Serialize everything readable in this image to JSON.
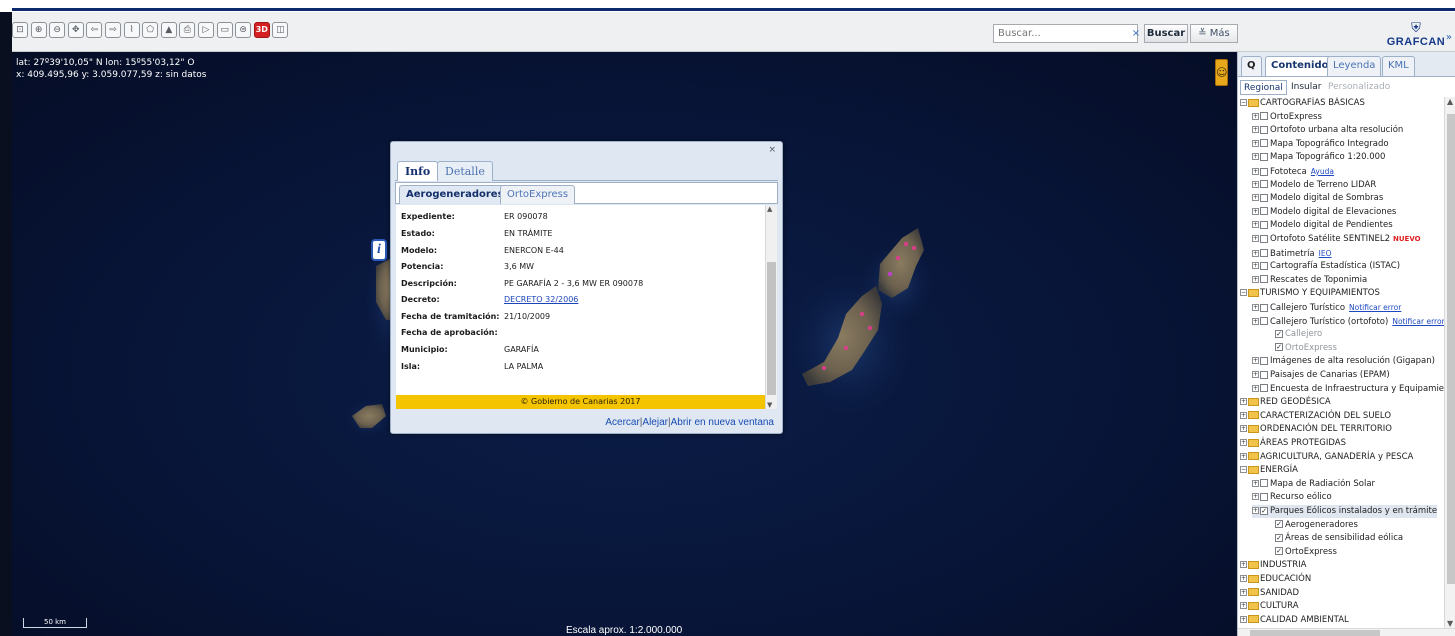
{
  "toolbar": {
    "tools": [
      "full-extent",
      "zoom-in",
      "zoom-out",
      "pan",
      "previous-view",
      "next-view",
      "measure-distance",
      "measure-area",
      "elevation-profile",
      "print",
      "draw",
      "layer-swipe",
      "layers",
      "3D",
      "window"
    ],
    "badge_3d": "3D",
    "search_placeholder": "Buscar...",
    "search_clear": "×",
    "search_button": "Buscar",
    "more_button": "≚ Más",
    "logo_shield": "⛨",
    "logo_text": "GRAFCAN",
    "logo_more": "»"
  },
  "map": {
    "coords_line1": "lat: 27º39'10,05\" N  lon: 15º55'03,12\" O",
    "coords_line2": "x: 409.495,96  y: 3.059.077,59  z: sin datos",
    "scale_bar": "50 km",
    "scale_text": "Escala aprox. 1:2.000.000",
    "info_marker": "i",
    "pegman": "☺",
    "colors": {
      "sea": "#081538",
      "land": "#7c6f58"
    }
  },
  "popup": {
    "close": "×",
    "tabs": [
      "Info",
      "Detalle"
    ],
    "sub_tabs": [
      "Aerogeneradores",
      "OrtoExpress"
    ],
    "rows": [
      {
        "label": "Expediente:",
        "value": "ER 090078"
      },
      {
        "label": "Estado:",
        "value": "EN TRÁMITE"
      },
      {
        "label": "Modelo:",
        "value": "ENERCON E-44"
      },
      {
        "label": "Potencia:",
        "value": "3,6 MW"
      },
      {
        "label": "Descripción:",
        "value": "PE GARAFÍA 2 - 3,6 MW ER 090078"
      },
      {
        "label": "Decreto:",
        "value": "DECRETO 32/2006"
      },
      {
        "label": "Fecha de tramitación:",
        "value": "21/10/2009"
      },
      {
        "label": "Fecha de aprobación:",
        "value": ""
      },
      {
        "label": "Municipio:",
        "value": "GARAFÍA"
      },
      {
        "label": "Isla:",
        "value": "LA PALMA"
      }
    ],
    "footer": "© Gobierno de Canarias 2017",
    "footer_color": "#f5c400",
    "links": {
      "acercar": "Acercar",
      "alejar": "Alejar",
      "abrir": "Abrir en nueva ventana",
      "sep": "|"
    }
  },
  "panel": {
    "search_tab": "Q",
    "tabs": [
      "Contenido",
      "Leyenda",
      "KML"
    ],
    "sub_tabs": [
      "Regional",
      "Insular",
      "Personalizado"
    ],
    "tree": [
      {
        "level": 0,
        "type": "folder",
        "label": "CARTOGRAFÍAS BÁSICAS",
        "expanded": true
      },
      {
        "level": 1,
        "type": "layer",
        "label": "OrtoExpress"
      },
      {
        "level": 1,
        "type": "layer",
        "label": "Ortofoto urbana alta resolución"
      },
      {
        "level": 1,
        "type": "layer",
        "label": "Mapa Topográfico Integrado"
      },
      {
        "level": 1,
        "type": "layer",
        "label": "Mapa Topográfico 1:20.000"
      },
      {
        "level": 1,
        "type": "layer",
        "label": "Fototeca",
        "link": "Ayuda"
      },
      {
        "level": 1,
        "type": "layer",
        "label": "Modelo de Terreno LIDAR"
      },
      {
        "level": 1,
        "type": "layer",
        "label": "Modelo digital de Sombras"
      },
      {
        "level": 1,
        "type": "layer",
        "label": "Modelo digital de Elevaciones"
      },
      {
        "level": 1,
        "type": "layer",
        "label": "Modelo digital de Pendientes"
      },
      {
        "level": 1,
        "type": "layer",
        "label": "Ortofoto Satélite SENTINEL2",
        "badge": "NUEVO"
      },
      {
        "level": 1,
        "type": "layer",
        "label": "Batimetría",
        "link": "IEO"
      },
      {
        "level": 1,
        "type": "layer",
        "label": "Cartografía Estadística (ISTAC)"
      },
      {
        "level": 1,
        "type": "layer",
        "label": "Rescates de Toponimia"
      },
      {
        "level": 0,
        "type": "folder",
        "label": "TURISMO Y EQUIPAMIENTOS",
        "expanded": true
      },
      {
        "level": 1,
        "type": "layer",
        "label": "Callejero Turístico",
        "link": "Notificar error"
      },
      {
        "level": 1,
        "type": "layer",
        "label": "Callejero Turístico (ortofoto)",
        "link": "Notificar error"
      },
      {
        "level": 2,
        "type": "sublayer",
        "label": "Callejero",
        "checked": true,
        "muted": true
      },
      {
        "level": 2,
        "type": "sublayer",
        "label": "OrtoExpress",
        "checked": true,
        "muted": true
      },
      {
        "level": 1,
        "type": "layer",
        "label": "Imágenes de alta resolución (Gigapan)"
      },
      {
        "level": 1,
        "type": "layer",
        "label": "Paisajes de Canarias (EPAM)"
      },
      {
        "level": 1,
        "type": "layer",
        "label": "Encuesta de Infraestructura y Equipamie"
      },
      {
        "level": 0,
        "type": "folder",
        "label": "RED GEODÉSICA"
      },
      {
        "level": 0,
        "type": "folder",
        "label": "CARACTERIZACIÓN DEL SUELO"
      },
      {
        "level": 0,
        "type": "folder",
        "label": "ORDENACIÓN DEL TERRITORIO"
      },
      {
        "level": 0,
        "type": "folder",
        "label": "ÁREAS PROTEGIDAS"
      },
      {
        "level": 0,
        "type": "folder",
        "label": "AGRICULTURA, GANADERÍA y PESCA"
      },
      {
        "level": 0,
        "type": "folder",
        "label": "ENERGÍA",
        "expanded": true
      },
      {
        "level": 1,
        "type": "layer",
        "label": "Mapa de Radiación Solar"
      },
      {
        "level": 1,
        "type": "layer",
        "label": "Recurso eólico"
      },
      {
        "level": 1,
        "type": "layer",
        "label": "Parques Eólicos instalados y en trámite",
        "checked": true,
        "selected": true
      },
      {
        "level": 2,
        "type": "sublayer",
        "label": "Aerogeneradores",
        "checked": true
      },
      {
        "level": 2,
        "type": "sublayer",
        "label": "Áreas de sensibilidad eólica",
        "checked": true
      },
      {
        "level": 2,
        "type": "sublayer",
        "label": "OrtoExpress",
        "checked": true
      },
      {
        "level": 0,
        "type": "folder",
        "label": "INDUSTRIA"
      },
      {
        "level": 0,
        "type": "folder",
        "label": "EDUCACIÓN"
      },
      {
        "level": 0,
        "type": "folder",
        "label": "SANIDAD"
      },
      {
        "level": 0,
        "type": "folder",
        "label": "CULTURA"
      },
      {
        "level": 0,
        "type": "folder",
        "label": "CALIDAD AMBIENTAL"
      }
    ]
  }
}
